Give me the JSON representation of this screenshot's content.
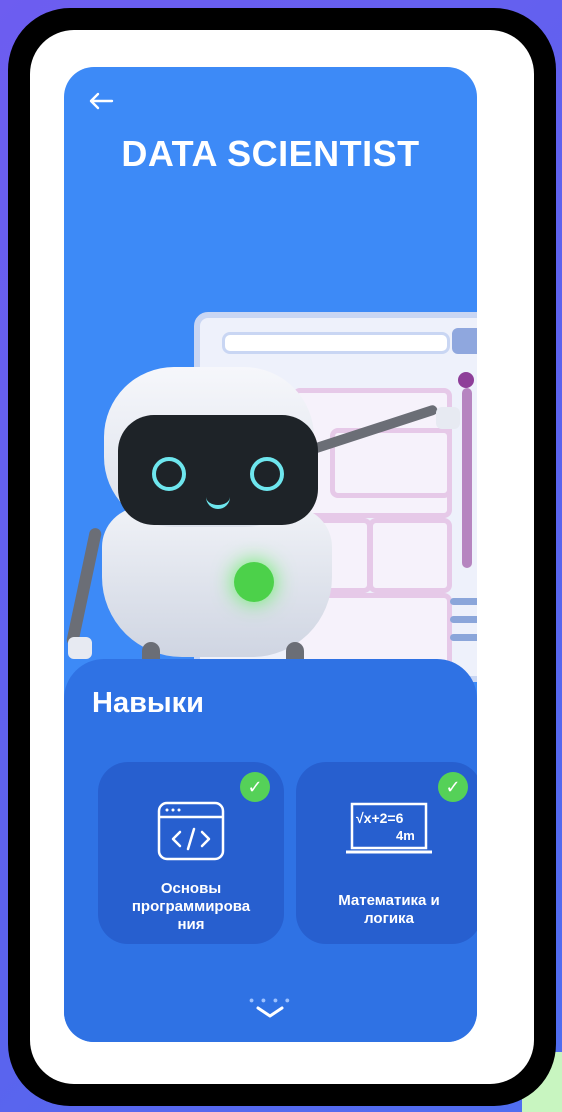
{
  "header": {
    "back_icon": "arrow-left-icon",
    "title": "DATA SCIENTIST"
  },
  "skills": {
    "title": "Навыки",
    "cards": [
      {
        "label_lines": [
          "Основы",
          "программирова",
          "ния"
        ],
        "icon": "code-window-icon",
        "completed": true,
        "check_icon": "check-icon"
      },
      {
        "label_lines": [
          "Математика и",
          "логика"
        ],
        "icon": "math-board-icon",
        "board_text": "√x+2=6",
        "board_sub": "4m",
        "completed": true,
        "check_icon": "check-icon"
      }
    ]
  },
  "footer": {
    "scroll_icon": "chevron-down-icon"
  },
  "colors": {
    "screen_bg": "#3d8af7",
    "panel_bg": "#2f72e4",
    "card_bg": "#275fcf",
    "check_green": "#55d158"
  }
}
